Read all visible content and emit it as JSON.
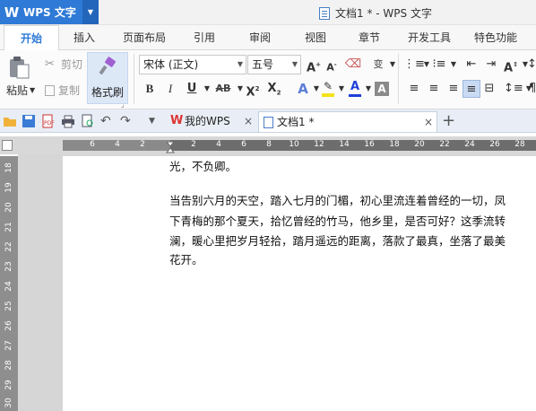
{
  "app": {
    "name": "WPS 文字",
    "window_title": "文档1 * - WPS 文字"
  },
  "menu_tabs": [
    {
      "label": "开始",
      "active": true
    },
    {
      "label": "插入"
    },
    {
      "label": "页面布局"
    },
    {
      "label": "引用"
    },
    {
      "label": "审阅"
    },
    {
      "label": "视图"
    },
    {
      "label": "章节"
    },
    {
      "label": "开发工具"
    },
    {
      "label": "特色功能"
    }
  ],
  "ribbon": {
    "paste_label": "粘贴",
    "cut_label": "剪切",
    "copy_label": "复制",
    "format_painter_label": "格式刷",
    "font_name": "宋体 (正文)",
    "font_size": "五号"
  },
  "doc_tabs": [
    {
      "label": "我的WPS"
    },
    {
      "label": "文档1 *",
      "active": true
    }
  ],
  "hruler_labels": [
    "6",
    "4",
    "2",
    "2",
    "4",
    "6",
    "8",
    "10",
    "12",
    "14",
    "16",
    "18",
    "20",
    "22",
    "24",
    "26",
    "28"
  ],
  "vruler_labels": [
    "18",
    "19",
    "20",
    "21",
    "22",
    "23",
    "24",
    "25",
    "26",
    "27",
    "28",
    "29",
    "30"
  ],
  "document": {
    "lines": [
      "光，不负卿。",
      "",
      "当告别六月的天空，踏入七月的门楣，初心里流连着曾经的一切，凤",
      "下青梅的那个夏天，拾忆曾经的竹马，他乡里，是否可好？这季流转",
      "澜，暖心里把岁月轻拾，踏月遥远的距离，落款了最真，坐落了最美",
      "花开。"
    ]
  },
  "colors": {
    "wps_blue": "#2e7ad6",
    "accent_red": "#d33",
    "highlight_yellow": "#f5e11a",
    "font_color_blue": "#1f3fd8"
  }
}
